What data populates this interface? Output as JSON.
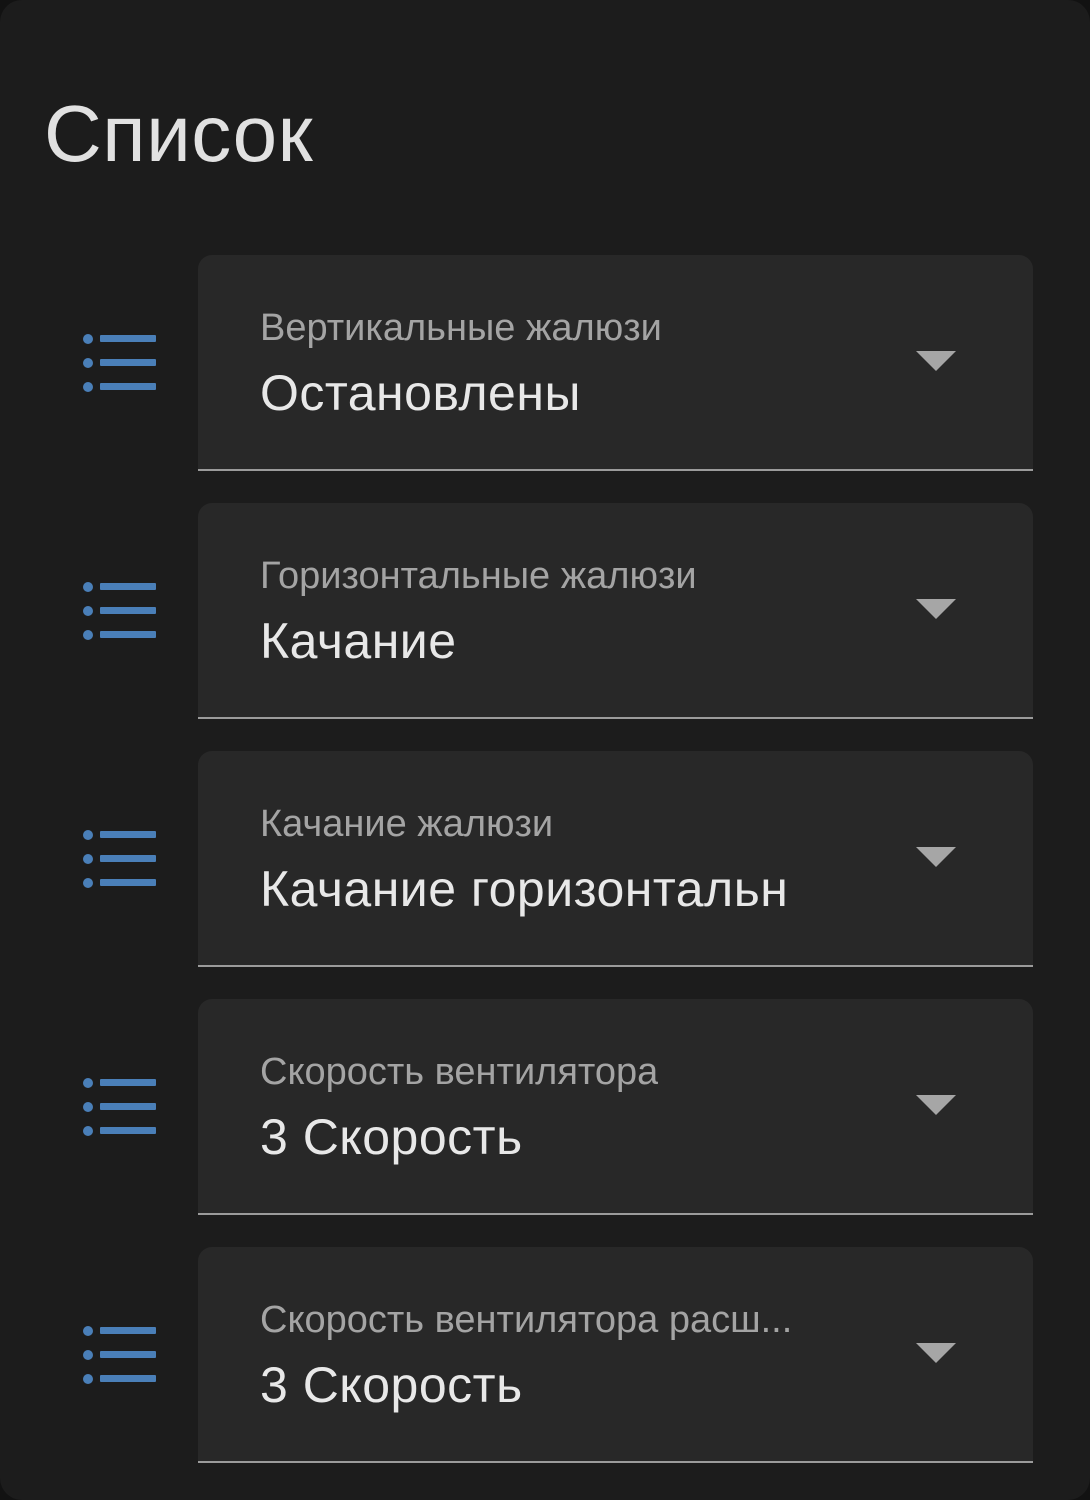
{
  "card": {
    "title": "Список"
  },
  "accent_color": "#4a7fb8",
  "rows": [
    {
      "icon": "format-list-bulleted-icon",
      "label": "Вертикальные жалюзи",
      "value": "Остановлены"
    },
    {
      "icon": "format-list-bulleted-icon",
      "label": "Горизонтальные жалюзи",
      "value": "Качание"
    },
    {
      "icon": "format-list-bulleted-icon",
      "label": "Качание жалюзи",
      "value": "Качание горизонтальн"
    },
    {
      "icon": "format-list-bulleted-icon",
      "label": "Скорость вентилятора",
      "value": "3 Скорость"
    },
    {
      "icon": "format-list-bulleted-icon",
      "label": "Скорость вентилятора расш...",
      "value": "3 Скорость"
    }
  ]
}
